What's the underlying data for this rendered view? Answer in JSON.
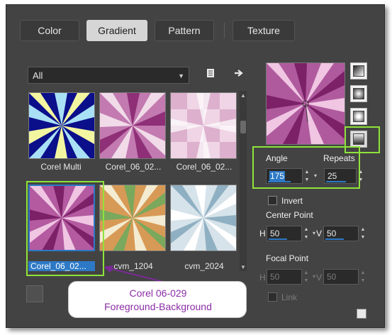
{
  "tabs": [
    {
      "label": "Color",
      "active": false
    },
    {
      "label": "Gradient",
      "active": true
    },
    {
      "label": "Pattern",
      "active": false
    },
    {
      "label": "Texture",
      "active": false
    }
  ],
  "category": {
    "selected": "All"
  },
  "toolbar": {
    "library_icon": "library-icon",
    "arrow_icon": "arrow-right-icon"
  },
  "gallery": {
    "items": [
      {
        "label": "Corel Multi",
        "selected": false
      },
      {
        "label": "Corel_06_02...",
        "selected": false
      },
      {
        "label": "Corel_06_02...",
        "selected": false
      },
      {
        "label": "Corel_06_02...",
        "selected": true
      },
      {
        "label": "cvm_1204",
        "selected": false
      },
      {
        "label": "cvm_2024",
        "selected": false
      }
    ]
  },
  "settings": {
    "angle_label": "Angle",
    "angle_value": "175",
    "repeats_label": "Repeats",
    "repeats_value": "25",
    "invert_label": "Invert",
    "center_point_label": "Center Point",
    "center_h_label": "H",
    "center_h_value": "50",
    "center_v_label": "V",
    "center_v_value": "50",
    "focal_point_label": "Focal Point",
    "focal_h_label": "H",
    "focal_h_value": "50",
    "focal_v_label": "V",
    "focal_v_value": "50",
    "link_label": "Link"
  },
  "callout": {
    "line1": "Corel 06-029",
    "line2": "Foreground-Background"
  },
  "colors": {
    "accent_green": "#8fe33b",
    "selection_blue": "#2d79c6",
    "callout_purple": "#8b2da6"
  }
}
